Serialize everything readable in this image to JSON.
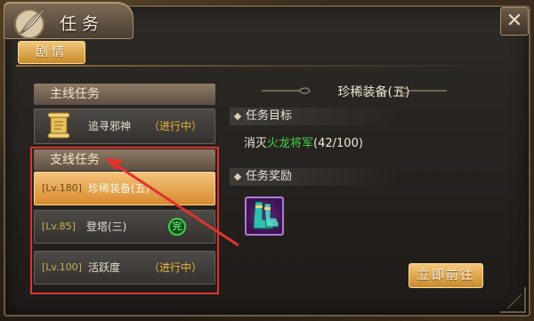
{
  "window": {
    "title": "任务",
    "close_label": "✕"
  },
  "tabs": [
    {
      "label": "剧情",
      "active": true
    }
  ],
  "left_panel": {
    "main_section": {
      "header": "主线任务",
      "quests": [
        {
          "name": "追寻邪神",
          "status": "（进行中）"
        }
      ]
    },
    "side_section": {
      "header": "支线任务",
      "quests": [
        {
          "level": "[Lv.180]",
          "name": "珍稀装备(五)",
          "selected": true
        },
        {
          "level": "[Lv.85]",
          "name": "登塔(三)",
          "complete_icon": "完"
        },
        {
          "level": "[Lv.100]",
          "name": "活跃度",
          "status": "（进行中）"
        }
      ]
    }
  },
  "right_panel": {
    "quest_title": "珍稀装备(五)",
    "objective_header": "任务目标",
    "objective": {
      "prefix": "消灭",
      "target": "火龙将军",
      "progress": "(42/100)"
    },
    "reward_header": "任务奖励",
    "reward_item_icon": "boots-icon",
    "go_button": "立即前往"
  },
  "colors": {
    "accent_gold": "#d88a2e",
    "status_yellow": "#e8b43c",
    "highlight_green": "#3fd24a",
    "annotation_red": "#e0332f"
  }
}
